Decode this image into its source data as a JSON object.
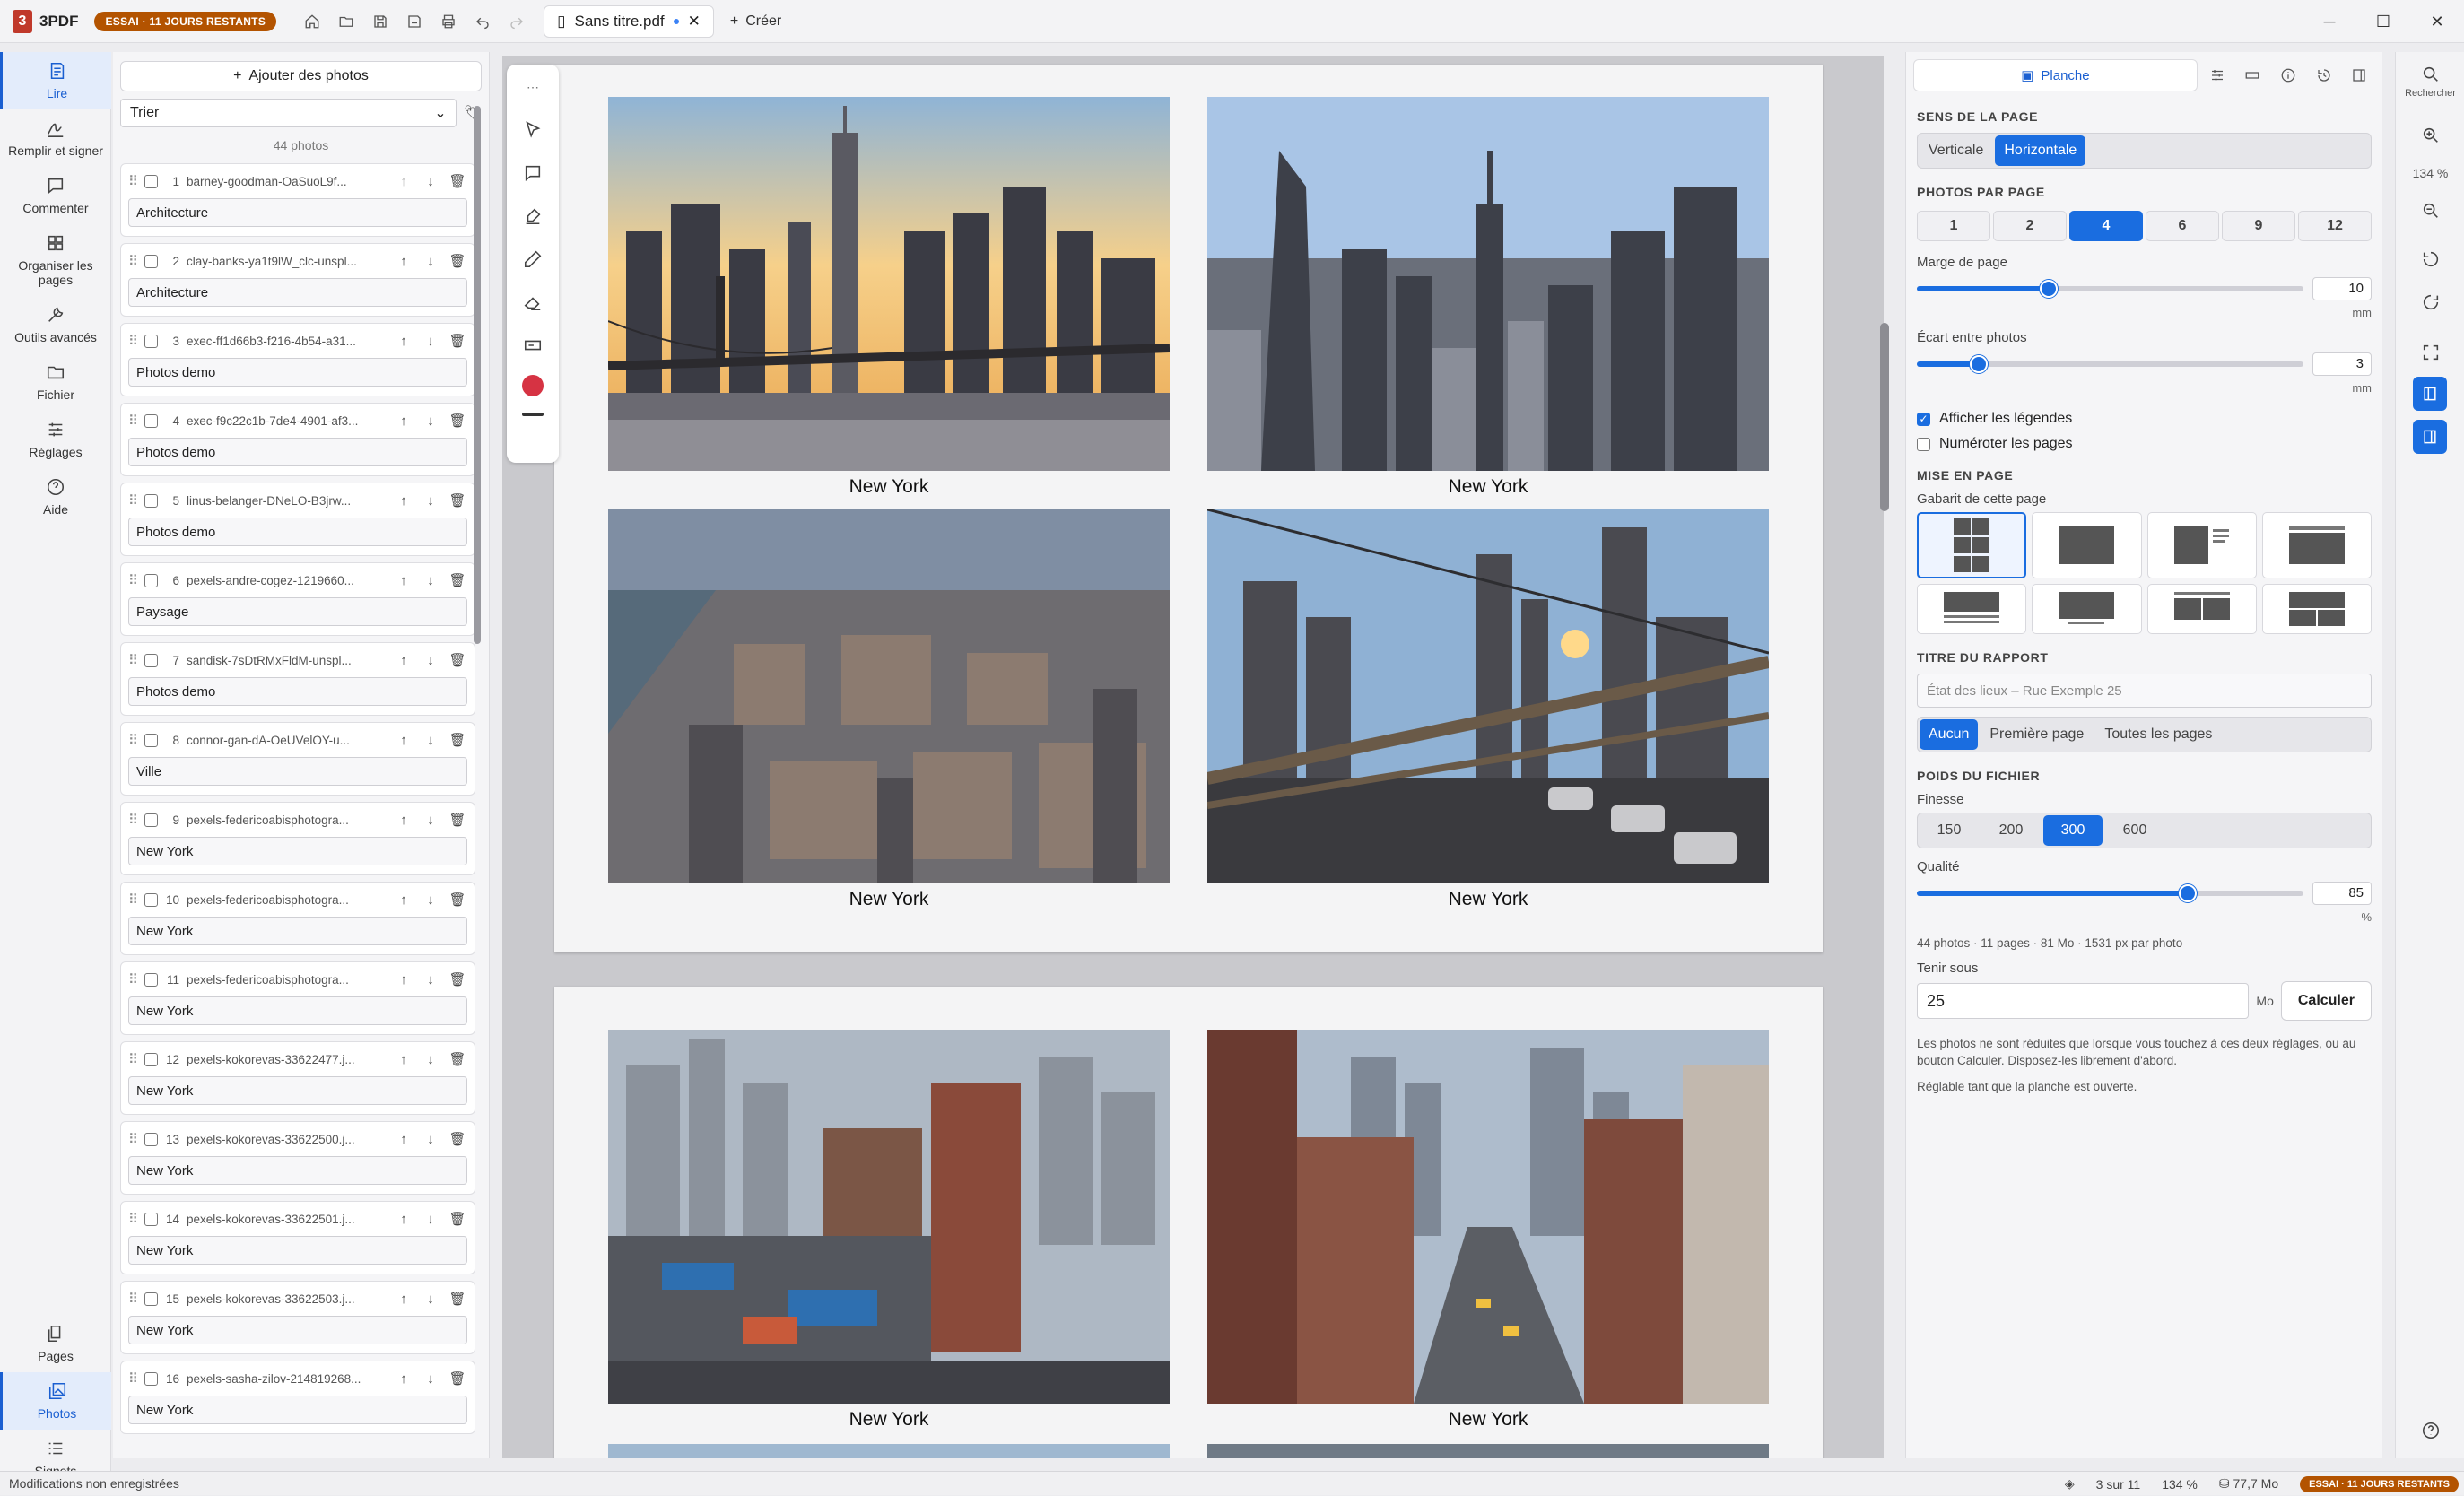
{
  "titlebar": {
    "app_name": "3PDF",
    "trial_badge": "ESSAI · 11 JOURS RESTANTS",
    "doc_tab": "Sans titre.pdf",
    "create_label": "Créer"
  },
  "left_rail": {
    "items": [
      {
        "label": "Lire",
        "icon": "book-icon"
      },
      {
        "label": "Remplir et signer",
        "icon": "signature-icon"
      },
      {
        "label": "Commenter",
        "icon": "comment-icon"
      },
      {
        "label": "Organiser les pages",
        "icon": "grid-icon"
      },
      {
        "label": "Outils avancés",
        "icon": "wrench-icon"
      },
      {
        "label": "Fichier",
        "icon": "folder-icon"
      },
      {
        "label": "Réglages",
        "icon": "sliders-icon"
      },
      {
        "label": "Aide",
        "icon": "help-icon"
      }
    ],
    "bottom_items": [
      {
        "label": "Pages",
        "icon": "pages-icon"
      },
      {
        "label": "Photos",
        "icon": "photos-icon"
      },
      {
        "label": "Signets",
        "icon": "bookmarks-icon"
      }
    ]
  },
  "photos_panel": {
    "add_label": "Ajouter des photos",
    "sort_label": "Trier",
    "count_label": "44 photos",
    "items": [
      {
        "num": "1",
        "name": "barney-goodman-OaSuoL9f...",
        "caption": "Architecture"
      },
      {
        "num": "2",
        "name": "clay-banks-ya1t9lW_clc-unspl...",
        "caption": "Architecture"
      },
      {
        "num": "3",
        "name": "exec-ff1d66b3-f216-4b54-a31...",
        "caption": "Photos demo"
      },
      {
        "num": "4",
        "name": "exec-f9c22c1b-7de4-4901-af3...",
        "caption": "Photos demo"
      },
      {
        "num": "5",
        "name": "linus-belanger-DNeLO-B3jrw...",
        "caption": "Photos demo"
      },
      {
        "num": "6",
        "name": "pexels-andre-cogez-1219660...",
        "caption": "Paysage"
      },
      {
        "num": "7",
        "name": "sandisk-7sDtRMxFldM-unspl...",
        "caption": "Photos demo"
      },
      {
        "num": "8",
        "name": "connor-gan-dA-OeUVelOY-u...",
        "caption": "Ville"
      },
      {
        "num": "9",
        "name": "pexels-federicoabisphotogra...",
        "caption": "New York"
      },
      {
        "num": "10",
        "name": "pexels-federicoabisphotogra...",
        "caption": "New York"
      },
      {
        "num": "11",
        "name": "pexels-federicoabisphotogra...",
        "caption": "New York"
      },
      {
        "num": "12",
        "name": "pexels-kokorevas-33622477.j...",
        "caption": "New York"
      },
      {
        "num": "13",
        "name": "pexels-kokorevas-33622500.j...",
        "caption": "New York"
      },
      {
        "num": "14",
        "name": "pexels-kokorevas-33622501.j...",
        "caption": "New York"
      },
      {
        "num": "15",
        "name": "pexels-kokorevas-33622503.j...",
        "caption": "New York"
      },
      {
        "num": "16",
        "name": "pexels-sasha-zilov-214819268...",
        "caption": "New York"
      }
    ]
  },
  "viewer": {
    "page1_captions": [
      "New York",
      "New York",
      "New York",
      "New York"
    ],
    "page2_captions": [
      "New York",
      "New York"
    ]
  },
  "right_panel": {
    "tab_label": "Planche",
    "orientation": {
      "title": "SENS DE LA PAGE",
      "options": [
        "Verticale",
        "Horizontale"
      ],
      "selected": "Horizontale"
    },
    "per_page": {
      "title": "PHOTOS PAR PAGE",
      "options": [
        "1",
        "2",
        "4",
        "6",
        "9",
        "12"
      ],
      "selected": "4"
    },
    "margin": {
      "label": "Marge de page",
      "value": "10",
      "unit": "mm",
      "fraction": 0.34
    },
    "gap": {
      "label": "Écart entre photos",
      "value": "3",
      "unit": "mm",
      "fraction": 0.16
    },
    "show_captions": "Afficher les légendes",
    "number_pages": "Numéroter les pages",
    "layout": {
      "title": "MISE EN PAGE",
      "label": "Gabarit de cette page"
    },
    "report_title": {
      "title": "TITRE DU RAPPORT",
      "placeholder": "État des lieux – Rue Exemple 25",
      "options": [
        "Aucun",
        "Première page",
        "Toutes les pages"
      ],
      "selected": "Aucun"
    },
    "file_weight": {
      "title": "POIDS DU FICHIER",
      "fineness_label": "Finesse",
      "fineness_options": [
        "150",
        "200",
        "300",
        "600"
      ],
      "fineness_selected": "300",
      "quality_label": "Qualité",
      "quality_value": "85",
      "quality_unit": "%",
      "quality_fraction": 0.7,
      "summary": "44 photos · 11 pages · 81 Mo · 1531 px par photo",
      "hold_label": "Tenir sous",
      "hold_value": "25",
      "hold_unit": "Mo",
      "calc_label": "Calculer",
      "note1": "Les photos ne sont réduites que lorsque vous touchez à ces deux réglages, ou au bouton Calculer. Disposez-les librement d'abord.",
      "note2": "Réglable tant que la planche est ouverte."
    }
  },
  "right_rail": {
    "search_label": "Rechercher",
    "zoom_label": "134 %"
  },
  "status": {
    "left": "Modifications non enregistrées",
    "page": "3 sur 11",
    "zoom": "134 %",
    "size": "77,7 Mo",
    "trial": "ESSAI · 11 JOURS RESTANTS"
  },
  "colors": {
    "accent": "#1a6de0",
    "trial": "#b35300",
    "brand": "#c0392b"
  }
}
